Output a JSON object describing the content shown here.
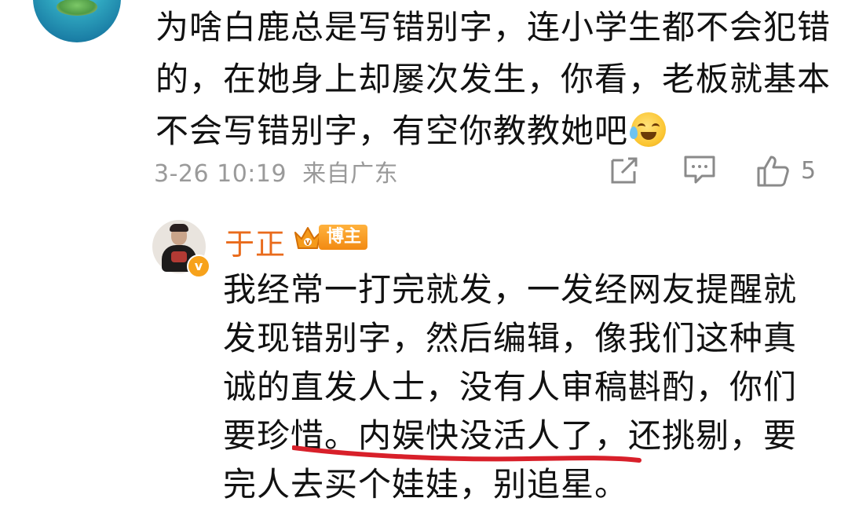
{
  "comment": {
    "text": "为啥白鹿总是写错别字，连小学生都不会犯错的，在她身上却屡次发生，你看，老板就基本不会写错别字，有空你教教她吧",
    "emoji": "laughing-crying-emoji",
    "date": "3-26 10:19",
    "location": "来自广东",
    "like_count": "5"
  },
  "reply": {
    "author": "于正",
    "badge": "博主",
    "verified_mark": "v",
    "text_before": "我经常一打完就发，一发经网友提醒就发现错别字，然后编辑，像我们这种真诚的直发人士，没有人审稿斟酌，你们要珍惜。",
    "text_highlight": "内娱快没活人了，还挑剔",
    "text_after": "，要完人去买个娃娃，别追星。"
  },
  "colors": {
    "name_orange": "#e96b1c",
    "meta_gray": "#9a9a9a",
    "underline_red": "#d8202a"
  },
  "icons": {
    "share": "share-icon",
    "comment": "comment-icon",
    "like": "thumbs-up-icon"
  }
}
